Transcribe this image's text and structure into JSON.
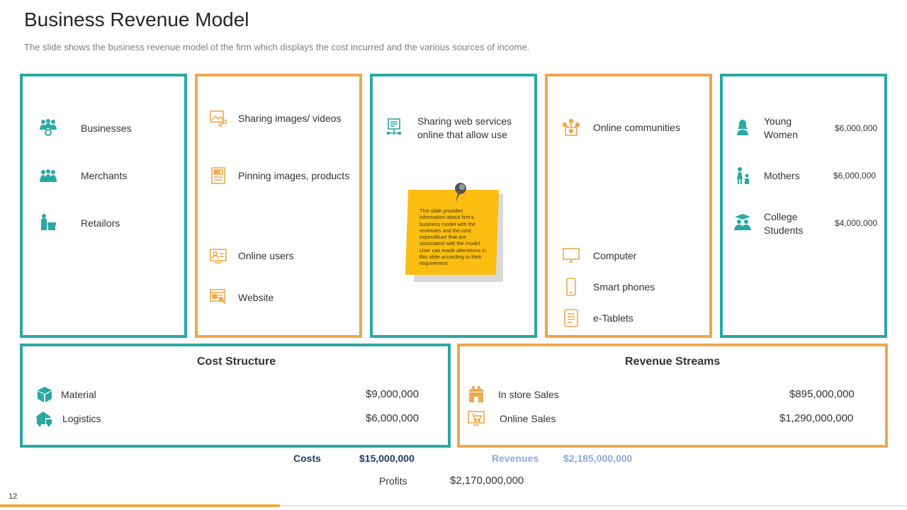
{
  "header": {
    "title": "Business Revenue Model",
    "subtitle": "The slide shows the business revenue model of the firm which displays the cost incurred and the various sources of income."
  },
  "colors": {
    "teal": "#2aa8a4",
    "orange": "#efa84c",
    "sticky_note": "#fbbd12"
  },
  "col1": {
    "items": [
      {
        "label": "Businesses",
        "icon": "businesses-icon"
      },
      {
        "label": "Merchants",
        "icon": "merchants-icon"
      },
      {
        "label": "Retailors",
        "icon": "retailors-icon"
      }
    ]
  },
  "col2": {
    "items": [
      {
        "label": "Sharing images/ videos",
        "icon": "share-images-icon"
      },
      {
        "label": "Pinning images, products",
        "icon": "pin-images-icon"
      },
      {
        "label": "Online users",
        "icon": "online-users-icon"
      },
      {
        "label": "Website",
        "icon": "website-icon"
      }
    ]
  },
  "col3": {
    "item_line1": "Sharing web services",
    "item_line2": "online that allow use",
    "icon": "web-services-icon",
    "note": "This slide provides information about firm’s business model with the revenues and the cost expenditure that are associated with the model. User can made alterations in this slide according to their requirement."
  },
  "col4": {
    "items": [
      {
        "label": "Online communities",
        "icon": "online-communities-icon"
      },
      {
        "label": "Computer",
        "icon": "computer-icon"
      },
      {
        "label": "Smart phones",
        "icon": "smartphone-icon"
      },
      {
        "label": "e-Tablets",
        "icon": "tablet-icon"
      }
    ]
  },
  "col5": {
    "items": [
      {
        "line1": "Young",
        "line2": "Women",
        "amount": "$6,000,000",
        "icon": "young-women-icon"
      },
      {
        "line1": "Mothers",
        "line2": "",
        "amount": "$6,000,000",
        "icon": "mothers-icon"
      },
      {
        "line1": "College",
        "line2": "Students",
        "amount": "$4,000,000",
        "icon": "college-students-icon"
      }
    ]
  },
  "cost": {
    "title": "Cost Structure",
    "items": [
      {
        "label": "Material",
        "amount": "$9,000,000",
        "icon": "material-box-icon"
      },
      {
        "label": "Logistics",
        "amount": "$6,000,000",
        "icon": "logistics-truck-icon"
      }
    ]
  },
  "revenue": {
    "title": "Revenue Streams",
    "items": [
      {
        "label": "In store Sales",
        "amount": "$895,000,000",
        "icon": "store-icon"
      },
      {
        "label": "Online Sales",
        "amount": "$1,290,000,000",
        "icon": "online-cart-icon"
      }
    ]
  },
  "summary": {
    "costs_label": "Costs",
    "costs_value": "$15,000,000",
    "revenues_label": "Revenues",
    "revenues_value": "$2,185,000,000",
    "profits_label": "Profits",
    "profits_value": "$2,170,000,000"
  },
  "footer": {
    "page_number": "12"
  }
}
